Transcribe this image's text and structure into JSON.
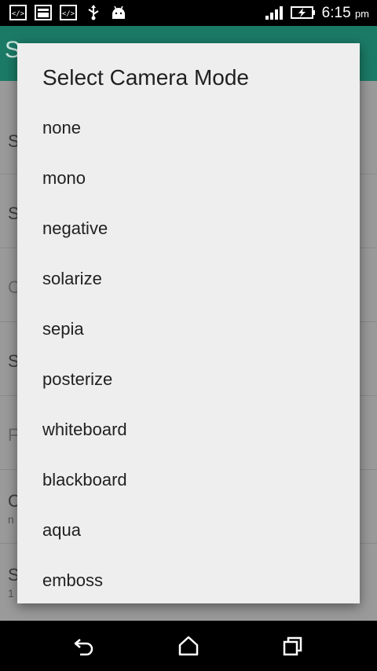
{
  "status_bar": {
    "time": "6:15",
    "ampm": "pm",
    "icons": [
      "code-icon",
      "image-icon",
      "code-icon",
      "usb-icon",
      "android-icon",
      "signal-icon",
      "battery-charging-icon"
    ]
  },
  "background_app": {
    "title_initial": "S",
    "rows": [
      {
        "letter": "S",
        "sub": ""
      },
      {
        "letter": "S",
        "sub": ""
      },
      {
        "letter": "C",
        "sub": ""
      },
      {
        "letter": "S",
        "sub": ""
      },
      {
        "letter": "F",
        "sub": ""
      },
      {
        "letter": "C",
        "sub": "n"
      },
      {
        "letter": "S",
        "sub": "1"
      }
    ]
  },
  "dialog": {
    "title": "Select Camera Mode",
    "options": [
      "none",
      "mono",
      "negative",
      "solarize",
      "sepia",
      "posterize",
      "whiteboard",
      "blackboard",
      "aqua",
      "emboss"
    ]
  },
  "nav_bar": {
    "icons": [
      "back-icon",
      "home-icon",
      "recents-icon"
    ]
  },
  "colors": {
    "app_bar": "#1b7a66",
    "dialog_bg": "#eeeeee",
    "scrim": "#9a9a9a"
  }
}
